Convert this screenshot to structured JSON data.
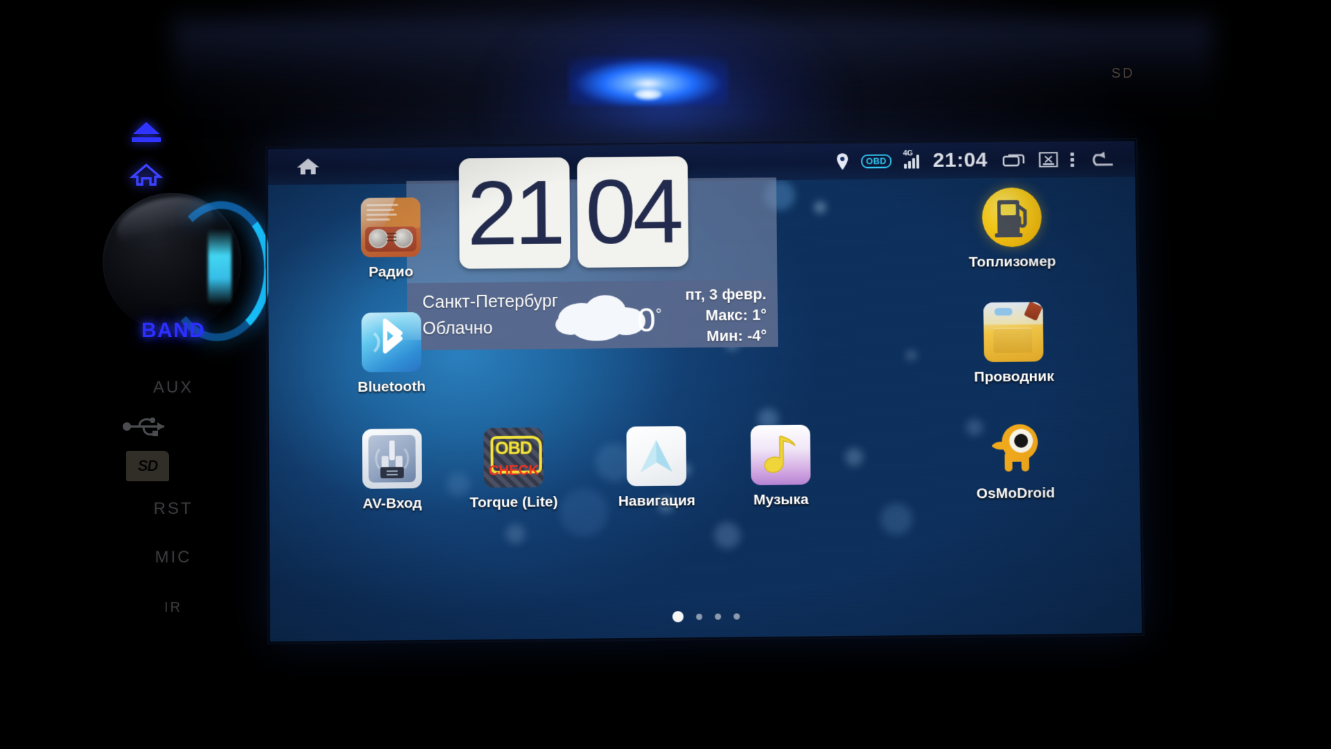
{
  "device": {
    "bezel": {
      "eject_icon": "eject-icon",
      "home_icon": "home-icon",
      "band_label": "BAND",
      "aux_label": "AUX",
      "usb_icon": "usb-icon",
      "sd_icon": "sd-card-icon",
      "sd_icon_text": "SD",
      "rst_label": "RST",
      "mic_label": "MIC",
      "ir_label": "IR",
      "sd_top_label": "SD"
    }
  },
  "statusbar": {
    "home_icon": "home-icon",
    "location_icon": "location-pin-icon",
    "obd_badge": "OBD",
    "network_type": "4G",
    "signal_icon": "signal-bars-icon",
    "time": "21:04",
    "recents_icon": "recents-icon",
    "screenshot_icon": "screenshot-icon",
    "overflow_icon": "overflow-menu-icon",
    "back_icon": "back-arrow-icon"
  },
  "clock_widget": {
    "hours": "21",
    "minutes": "04"
  },
  "weather_widget": {
    "city": "Санкт-Петербург",
    "condition": "Облачно",
    "condition_icon": "cloud-icon",
    "temperature": "0",
    "degree": "°",
    "date": "пт, 3 февр.",
    "max": "Макс:  1°",
    "min": "Мин: -4°"
  },
  "apps": {
    "radio": {
      "label": "Радио",
      "icon": "radio-icon"
    },
    "bluetooth": {
      "label": "Bluetooth",
      "icon": "bluetooth-icon"
    },
    "av_input": {
      "label": "AV-Вход",
      "icon": "av-input-icon"
    },
    "torque": {
      "label": "Torque (Lite)",
      "icon": "obd-check-icon",
      "badge_top": "OBD",
      "badge_bottom": "CHECK"
    },
    "navigation": {
      "label": "Навигация",
      "icon": "navigation-arrow-icon"
    },
    "music": {
      "label": "Музыка",
      "icon": "music-note-icon"
    },
    "fuel": {
      "label": "Топлизомер",
      "icon": "fuel-pump-icon"
    },
    "explorer": {
      "label": "Проводник",
      "icon": "folder-icon"
    },
    "osmodroid": {
      "label": "OsMoDroid",
      "icon": "osmo-eye-icon"
    }
  },
  "pager": {
    "pages": 4,
    "active_index": 0
  },
  "colors": {
    "screen_bg": "#1d6aa6",
    "statusbar_bg": "#0b1738",
    "accent_blue": "#2f34ff",
    "knob_glow": "#16c6ff",
    "widget_panel": "#808eac",
    "weather_panel": "#56668b"
  }
}
